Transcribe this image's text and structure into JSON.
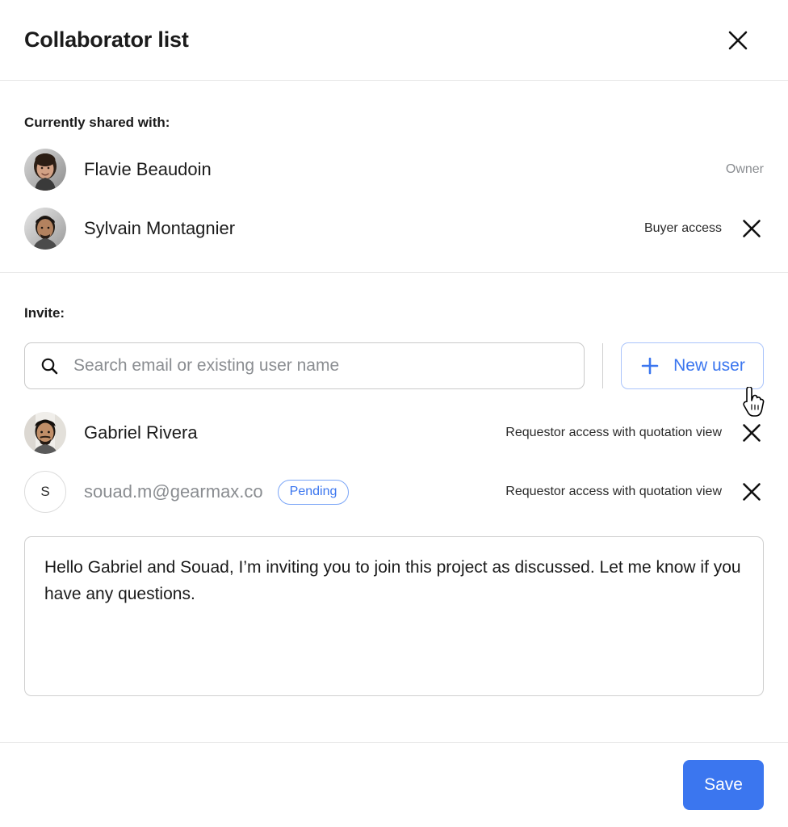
{
  "dialog": {
    "title": "Collaborator list",
    "close_icon": "close-icon"
  },
  "shared": {
    "label": "Currently shared with:",
    "people": [
      {
        "name": "Flavie Beaudoin",
        "access": "Owner",
        "avatar_type": "photo",
        "removable": false
      },
      {
        "name": "Sylvain Montagnier",
        "access": "Buyer access",
        "avatar_type": "photo",
        "removable": true
      }
    ]
  },
  "invite": {
    "label": "Invite:",
    "search": {
      "placeholder": "Search email or existing user name",
      "value": "",
      "icon": "search-icon"
    },
    "new_user_button": {
      "label": "New user",
      "icon": "plus-icon"
    },
    "invitees": [
      {
        "name": "Gabriel Rivera",
        "access": "Requestor access with quotation view",
        "avatar_type": "photo",
        "badge": "",
        "muted": false
      },
      {
        "name": "souad.m@gearmax.co",
        "access": "Requestor access with quotation view",
        "avatar_type": "initial",
        "initial": "S",
        "badge": "Pending",
        "muted": true
      }
    ],
    "message": "Hello Gabriel and Souad, I’m inviting you to join this project as discussed. Let me know if you have any questions."
  },
  "footer": {
    "save_label": "Save"
  },
  "colors": {
    "accent": "#3b76ef",
    "accent_border": "#aac4fb",
    "text": "#1b1b1b",
    "muted_text": "#8a8d91",
    "divider": "#e8e8e8",
    "input_border": "#c9c9c9"
  }
}
